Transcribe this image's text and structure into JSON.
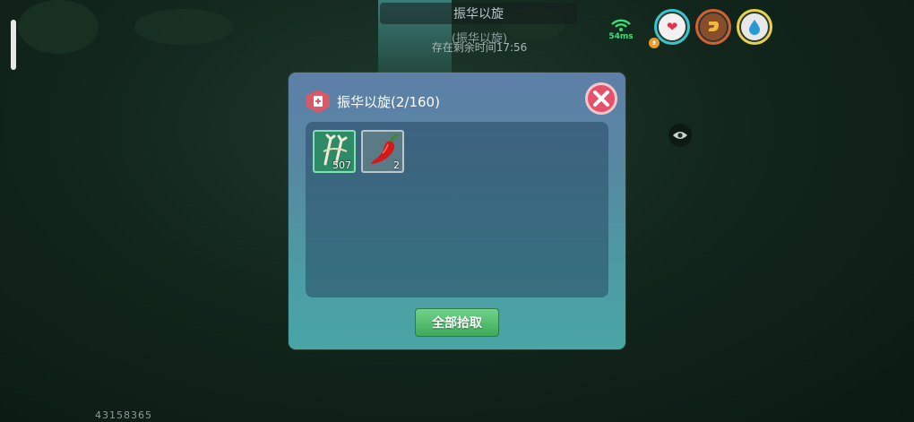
{
  "hud": {
    "banner_title": "振华以旋",
    "sub_name": "(振华以旋)",
    "timer_text": "存在剩余时间17:56",
    "ping": "54ms",
    "player_id": "43158365"
  },
  "dialog": {
    "title": "振华以旋(2/160)",
    "items": [
      {
        "name": "bones-icon",
        "quantity": "507"
      },
      {
        "name": "chili-pepper-icon",
        "quantity": "2"
      }
    ],
    "collect_all_label": "全部拾取"
  },
  "colors": {
    "health_ring": "#37c6c9",
    "hunger_ring": "#d5612f",
    "thirst_ring": "#e8d24a",
    "close_button": "#e6506a",
    "collect_button": "#4fba6d"
  }
}
